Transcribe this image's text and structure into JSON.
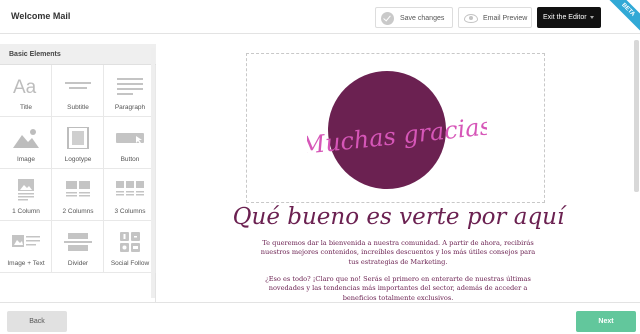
{
  "header": {
    "title": "Welcome Mail",
    "save_label": "Save changes",
    "preview_label": "Email Preview",
    "exit_label": "Exit the Editor",
    "beta_label": "BETA"
  },
  "sidebar": {
    "heading": "Basic Elements",
    "items": [
      {
        "label": "Title",
        "icon": "title-icon"
      },
      {
        "label": "Subtitle",
        "icon": "subtitle-icon"
      },
      {
        "label": "Paragraph",
        "icon": "paragraph-icon"
      },
      {
        "label": "Image",
        "icon": "image-icon"
      },
      {
        "label": "Logotype",
        "icon": "logotype-icon"
      },
      {
        "label": "Button",
        "icon": "button-icon"
      },
      {
        "label": "1 Column",
        "icon": "one-column-icon"
      },
      {
        "label": "2 Columns",
        "icon": "two-columns-icon"
      },
      {
        "label": "3 Columns",
        "icon": "three-columns-icon"
      },
      {
        "label": "Image + Text",
        "icon": "image-text-icon"
      },
      {
        "label": "Divider",
        "icon": "divider-icon"
      },
      {
        "label": "Social Follow",
        "icon": "social-follow-icon"
      }
    ]
  },
  "email": {
    "hero_script": "¡Muchas gracias!",
    "headline": "Qué bueno es verte por aquí",
    "paragraph1": [
      "Te queremos dar la bienvenida a nuestra comunidad. A partir de ahora, recibirás",
      "nuestros mejores contenidos, increíbles descuentos y los más útiles consejos para",
      "tus estrategias de Marketing."
    ],
    "paragraph2": [
      "¿Eso es todo? ¡Claro que no! Serás el primero en enterarte de nuestras últimas",
      "novedades y las tendencias más importantes del sector, además de acceder a",
      "beneficios totalmente exclusivos."
    ]
  },
  "footer": {
    "back_label": "Back",
    "next_label": "Next"
  },
  "colors": {
    "accent_plum": "#6b2151",
    "script_pink": "#d656b8",
    "next_green": "#62c79c",
    "beta_blue": "#31a9d6"
  }
}
